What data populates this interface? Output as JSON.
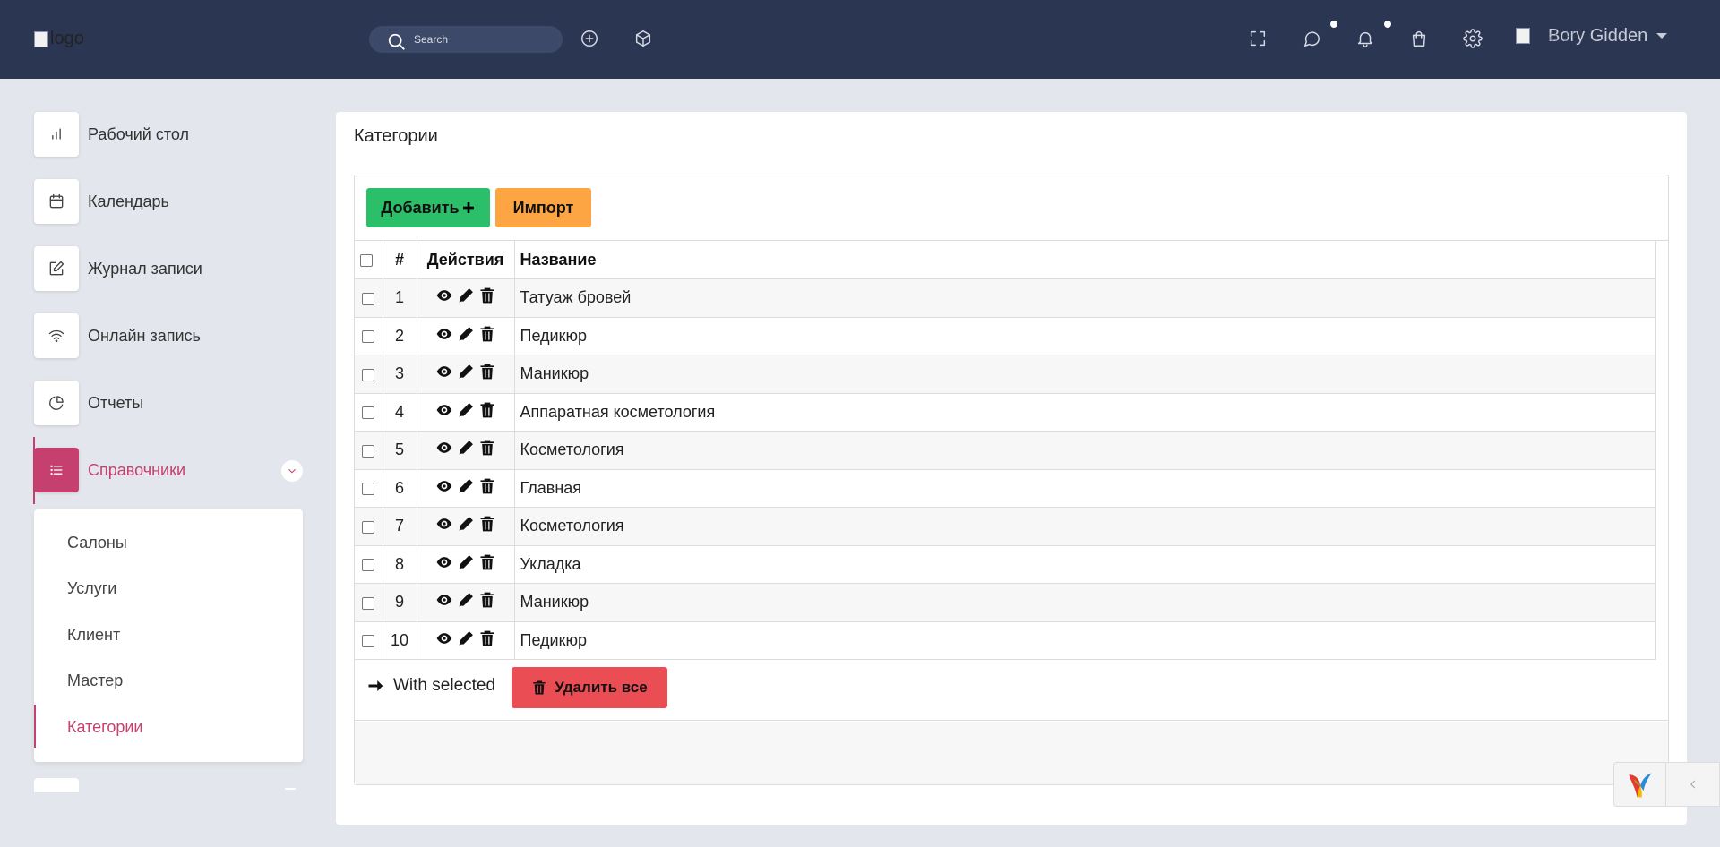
{
  "header": {
    "logo_alt": "logo",
    "search_placeholder": "Search",
    "avatar_alt": "avatar",
    "user_name": "Bory Gidden"
  },
  "sidebar": {
    "items": [
      {
        "label": "Рабочий стол",
        "icon": "bar-chart-icon"
      },
      {
        "label": "Календарь",
        "icon": "calendar-icon"
      },
      {
        "label": "Журнал записи",
        "icon": "edit-icon"
      },
      {
        "label": "Онлайн запись",
        "icon": "wifi-icon"
      },
      {
        "label": "Отчеты",
        "icon": "pie-chart-icon"
      },
      {
        "label": "Справочники",
        "icon": "list-icon"
      }
    ],
    "submenu": [
      "Салоны",
      "Услуги",
      "Клиент",
      "Мастер",
      "Категории"
    ]
  },
  "page": {
    "title": "Категории",
    "add_label": "Добавить",
    "import_label": "Импорт"
  },
  "table": {
    "headers": {
      "num": "#",
      "actions": "Действия",
      "name": "Название"
    },
    "rows": [
      {
        "num": "1",
        "name": "Татуаж бровей"
      },
      {
        "num": "2",
        "name": "Педикюр"
      },
      {
        "num": "3",
        "name": "Маникюр"
      },
      {
        "num": "4",
        "name": "Аппаратная косметология"
      },
      {
        "num": "5",
        "name": "Косметология"
      },
      {
        "num": "6",
        "name": "Главная"
      },
      {
        "num": "7",
        "name": "Косметология"
      },
      {
        "num": "8",
        "name": "Укладка"
      },
      {
        "num": "9",
        "name": "Маникюр"
      },
      {
        "num": "10",
        "name": "Педикюр"
      }
    ]
  },
  "bulk": {
    "with_selected": "With selected",
    "delete_all": "Удалить все"
  },
  "colors": {
    "header_bg": "#2b3652",
    "accent": "#c6406f",
    "add_button": "#2bbf6a",
    "import_button": "#fda443",
    "delete_button": "#ea4d54"
  }
}
